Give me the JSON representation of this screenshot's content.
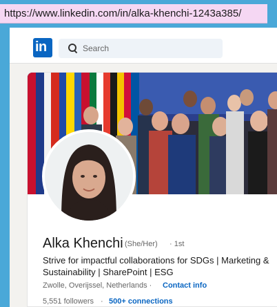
{
  "browser": {
    "url": "https://www.linkedin.com/in/alka-khenchi-1243a385/"
  },
  "nav": {
    "logo_text": "in",
    "search_placeholder": "Search"
  },
  "profile": {
    "name": "Alka Khenchi",
    "pronouns": "(She/Her)",
    "degree": "· 1st",
    "headline": "Strive for impactful collaborations for SDGs | Marketing & Sustainability | SharePoint | ESG",
    "location": "Zwolle, Overijssel, Netherlands ·",
    "contact_info": "Contact info",
    "followers": "5,551 followers",
    "separator": "·",
    "connections": "500+ connections"
  },
  "colors": {
    "brand": "#0a66c2",
    "url_highlight": "#f5d7f3",
    "page_bg": "#f3f2ef"
  }
}
